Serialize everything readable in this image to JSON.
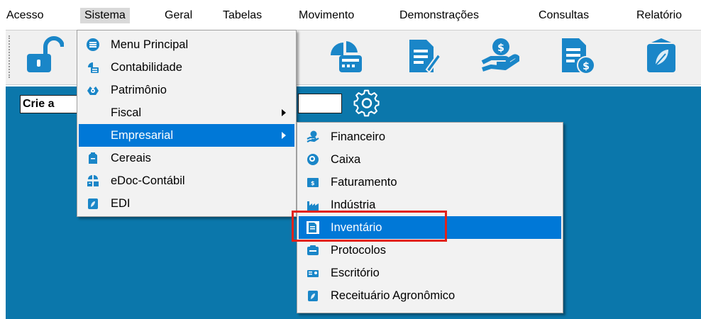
{
  "menubar": {
    "items": [
      {
        "label": "Acesso"
      },
      {
        "label": "Sistema"
      },
      {
        "label": "Geral"
      },
      {
        "label": "Tabelas"
      },
      {
        "label": "Movimento"
      },
      {
        "label": "Demonstrações"
      },
      {
        "label": "Consultas"
      },
      {
        "label": "Relatório"
      }
    ]
  },
  "toolbar": {
    "buttons": [
      {
        "icon": "padlock-unlocked-icon"
      },
      {
        "icon": "chart-calculator-icon"
      },
      {
        "icon": "document-edit-icon"
      },
      {
        "icon": "hand-money-icon"
      },
      {
        "icon": "document-coin-icon"
      },
      {
        "icon": "leaf-card-icon"
      }
    ]
  },
  "main": {
    "crie_text": "Crie a"
  },
  "sistema_menu": {
    "items": [
      {
        "label": "Menu Principal",
        "icon": "menu-list-icon"
      },
      {
        "label": "Contabilidade",
        "icon": "accounting-icon"
      },
      {
        "label": "Patrimônio",
        "icon": "asset-hands-icon"
      },
      {
        "label": "Fiscal",
        "icon": "",
        "submenu": true
      },
      {
        "label": "Empresarial",
        "icon": "",
        "submenu": true,
        "selected": true
      },
      {
        "label": "Cereais",
        "icon": "grain-icon"
      },
      {
        "label": "eDoc-Contábil",
        "icon": "edoc-icon"
      },
      {
        "label": "EDI",
        "icon": "edi-icon"
      }
    ]
  },
  "empresarial_menu": {
    "items": [
      {
        "label": "Financeiro",
        "icon": "hand-money-icon"
      },
      {
        "label": "Caixa",
        "icon": "cash-icon"
      },
      {
        "label": "Faturamento",
        "icon": "invoice-icon"
      },
      {
        "label": "Indústria",
        "icon": "factory-icon"
      },
      {
        "label": "Inventário",
        "icon": "inventory-icon",
        "selected": true
      },
      {
        "label": "Protocolos",
        "icon": "protocol-icon"
      },
      {
        "label": "Escritório",
        "icon": "office-icon"
      },
      {
        "label": "Receituário Agronômico",
        "icon": "leaf-prescription-icon"
      }
    ]
  },
  "colors": {
    "accent_selected": "#0078d7",
    "main_background": "#0b77ab",
    "icon_blue": "#1a86c8",
    "highlight_red": "#e2231a"
  }
}
